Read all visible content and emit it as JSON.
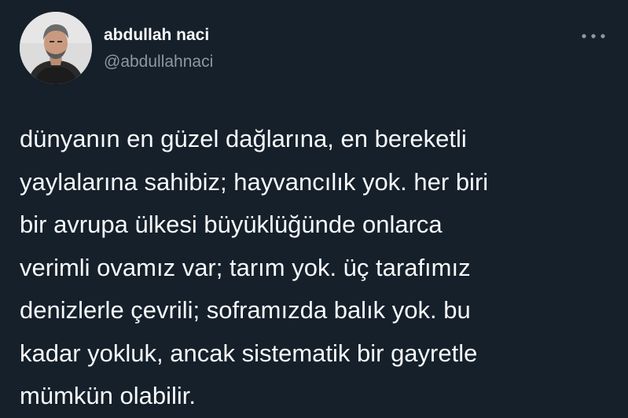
{
  "tweet": {
    "author": {
      "display_name": "abdullah naci",
      "handle": "@abdullahnaci",
      "avatar_icon": "avatar-photo"
    },
    "more_icon": "more-horizontal-icon",
    "text": "dünyanın en güzel dağlarına, en bereketli\nyaylalarına sahibiz; hayvancılık yok. her biri\nbir avrupa ülkesi büyüklüğünde onlarca\nverimli ovamız var; tarım yok. üç tarafımız\ndenizlerle çevrili; soframızda balık yok. bu\nkadar yokluk, ancak sistematik bir gayretle\nmümkün olabilir."
  },
  "colors": {
    "background": "#15202b",
    "text_primary": "#f7f9f9",
    "text_secondary": "#8b98a5"
  }
}
